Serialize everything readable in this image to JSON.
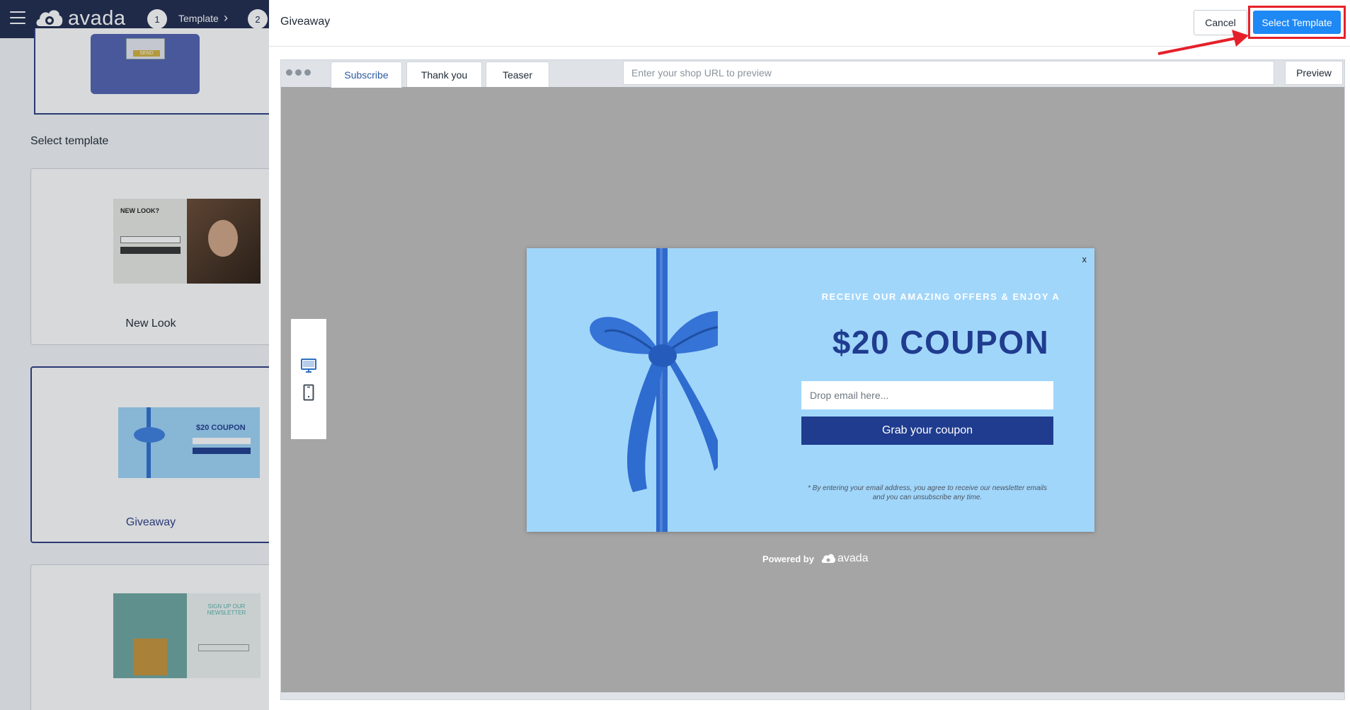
{
  "topbar": {
    "logo_text": "avada",
    "steps": [
      {
        "number": "1",
        "label": "Template"
      },
      {
        "number": "2"
      }
    ]
  },
  "background": {
    "prev_card_tag": "SEND",
    "select_template_heading": "Select template",
    "templates": [
      {
        "name": "New Look",
        "thumb_title": "NEW LOOK?"
      },
      {
        "name": "Giveaway",
        "thumb_title": "$20 COUPON",
        "selected": true
      },
      {
        "thumb_title": "SIGN UP OUR NEWSLETTER"
      }
    ]
  },
  "drawer": {
    "title": "Giveaway",
    "cancel_label": "Cancel",
    "select_label": "Select Template"
  },
  "preview": {
    "tabs": [
      "Subscribe",
      "Thank you",
      "Teaser"
    ],
    "active_tab": "Subscribe",
    "url_placeholder": "Enter your shop URL to preview",
    "preview_label": "Preview"
  },
  "popup": {
    "close": "x",
    "subheading": "RECEIVE OUR AMAZING OFFERS & ENJOY A",
    "heading": "$20 COUPON",
    "email_placeholder": "Drop email here...",
    "button": "Grab your coupon",
    "disclaimer": "* By entering your email address, you agree to receive our newsletter emails and you can unsubscribe any time.",
    "background_color": "#a1d6fb",
    "accent_color": "#1f3c8f"
  },
  "powered": {
    "text": "Powered by",
    "brand": "avada"
  },
  "icons": [
    "hamburger-icon",
    "avada-logo-icon",
    "chevron-right-icon",
    "desktop-icon",
    "mobile-icon",
    "close-icon"
  ],
  "colors": {
    "topbar": "#1f2a4d",
    "primary_button": "#1e88f5",
    "annotation": "#e5202a"
  }
}
